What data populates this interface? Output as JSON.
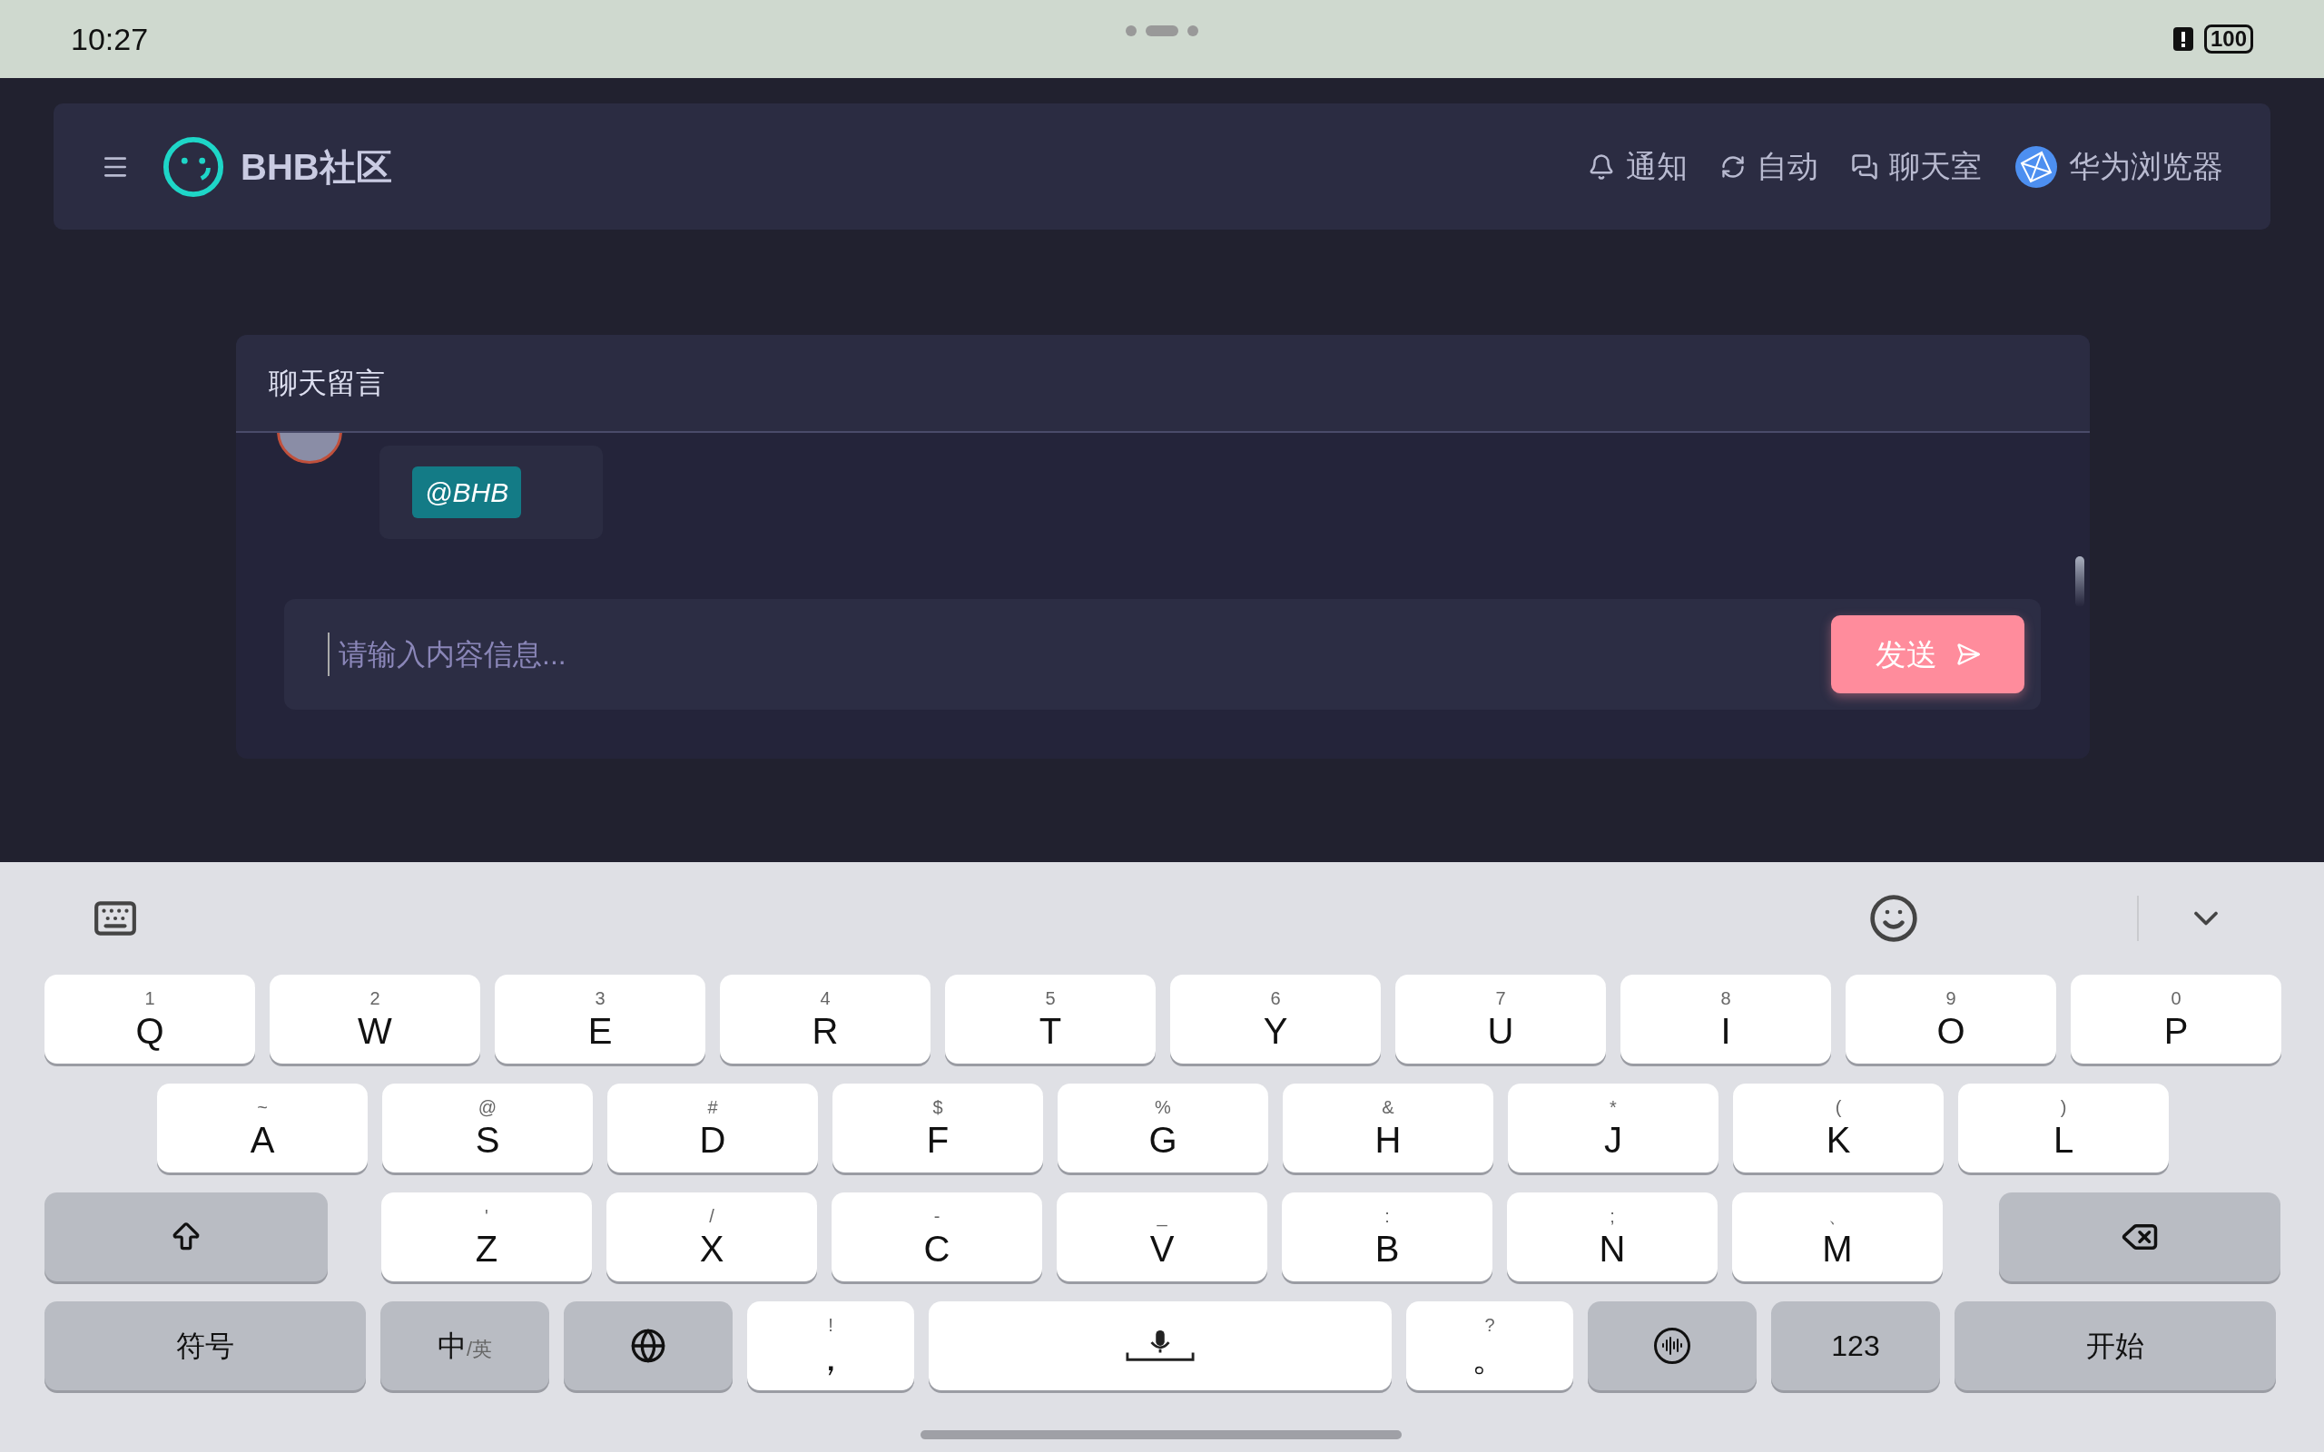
{
  "status_bar": {
    "time": "10:27",
    "battery": "100"
  },
  "header": {
    "brand": "BHB社区",
    "nav": [
      {
        "kind": "bell",
        "label": "通知"
      },
      {
        "kind": "refresh",
        "label": "自动"
      },
      {
        "kind": "chat",
        "label": "聊天室"
      },
      {
        "kind": "browser",
        "label": "华为浏览器"
      }
    ]
  },
  "chat": {
    "title": "聊天留言",
    "messages": [
      {
        "tag": "@BHB"
      }
    ],
    "input": {
      "placeholder": "请输入内容信息..."
    },
    "send_button": "发送"
  },
  "keyboard": {
    "rows": [
      [
        {
          "kind": "letter",
          "label": "Q",
          "sub": "1"
        },
        {
          "kind": "letter",
          "label": "W",
          "sub": "2"
        },
        {
          "kind": "letter",
          "label": "E",
          "sub": "3"
        },
        {
          "kind": "letter",
          "label": "R",
          "sub": "4"
        },
        {
          "kind": "letter",
          "label": "T",
          "sub": "5"
        },
        {
          "kind": "letter",
          "label": "Y",
          "sub": "6"
        },
        {
          "kind": "letter",
          "label": "U",
          "sub": "7"
        },
        {
          "kind": "letter",
          "label": "I",
          "sub": "8"
        },
        {
          "kind": "letter",
          "label": "O",
          "sub": "9"
        },
        {
          "kind": "letter",
          "label": "P",
          "sub": "0"
        }
      ],
      [
        {
          "kind": "letter",
          "label": "A",
          "sub": "~"
        },
        {
          "kind": "letter",
          "label": "S",
          "sub": "@"
        },
        {
          "kind": "letter",
          "label": "D",
          "sub": "#"
        },
        {
          "kind": "letter",
          "label": "F",
          "sub": "$"
        },
        {
          "kind": "letter",
          "label": "G",
          "sub": "%"
        },
        {
          "kind": "letter",
          "label": "H",
          "sub": "&"
        },
        {
          "kind": "letter",
          "label": "J",
          "sub": "*"
        },
        {
          "kind": "letter",
          "label": "K",
          "sub": "("
        },
        {
          "kind": "letter",
          "label": "L",
          "sub": ")"
        }
      ],
      [
        {
          "kind": "shift"
        },
        {
          "kind": "letter",
          "label": "Z",
          "sub": "'"
        },
        {
          "kind": "letter",
          "label": "X",
          "sub": "/"
        },
        {
          "kind": "letter",
          "label": "C",
          "sub": "-"
        },
        {
          "kind": "letter",
          "label": "V",
          "sub": "_"
        },
        {
          "kind": "letter",
          "label": "B",
          "sub": ":"
        },
        {
          "kind": "letter",
          "label": "N",
          "sub": ";"
        },
        {
          "kind": "letter",
          "label": "M",
          "sub": "、"
        },
        {
          "kind": "backspace"
        }
      ],
      [
        {
          "kind": "function",
          "label": "符号"
        },
        {
          "kind": "lang",
          "label": "中",
          "sub": "/英"
        },
        {
          "kind": "globe"
        },
        {
          "kind": "letter",
          "label": "，",
          "sub": "!"
        },
        {
          "kind": "space"
        },
        {
          "kind": "letter",
          "label": "。",
          "sub": "?"
        },
        {
          "kind": "voice"
        },
        {
          "kind": "function",
          "label": "123"
        },
        {
          "kind": "function",
          "label": "开始"
        }
      ]
    ]
  }
}
